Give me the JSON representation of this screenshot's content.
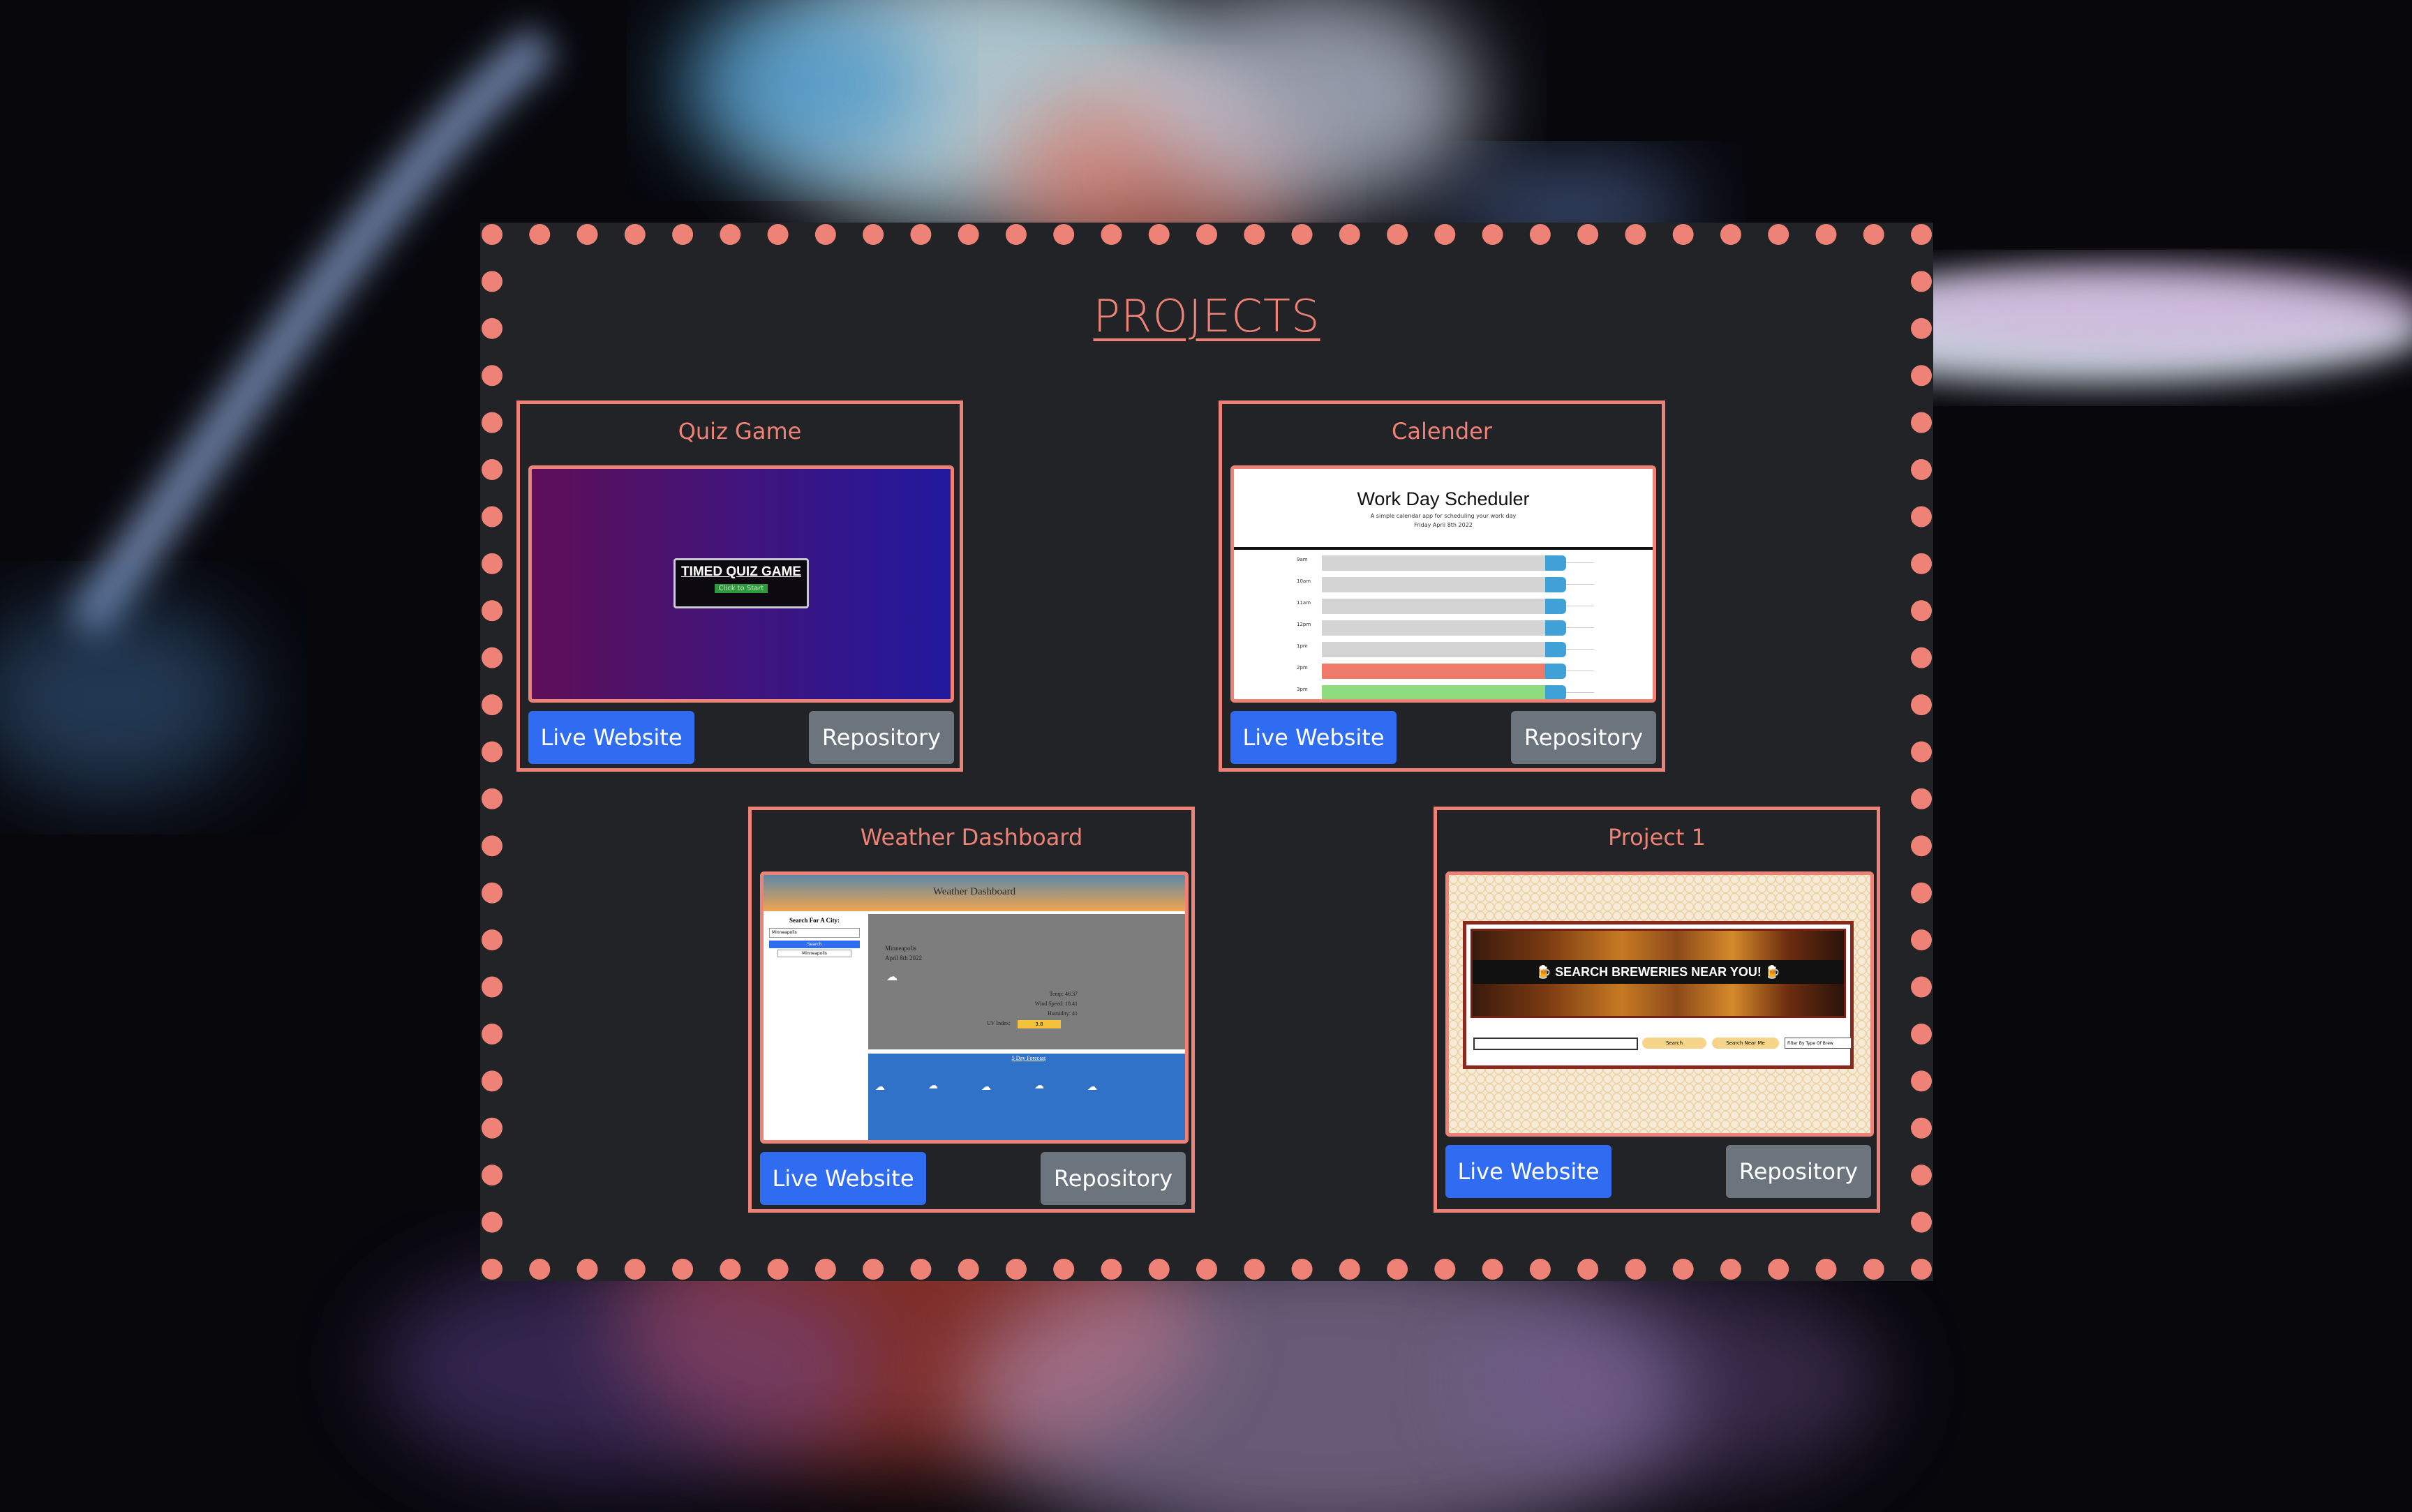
{
  "page": {
    "title": "PROJECTS"
  },
  "projects": [
    {
      "title": "Quiz Game",
      "live_label": "Live Website",
      "repo_label": "Repository",
      "preview": {
        "heading": "TIMED QUIZ GAME",
        "button": "Click to Start"
      }
    },
    {
      "title": "Calender",
      "live_label": "Live Website",
      "repo_label": "Repository",
      "preview": {
        "heading": "Work Day Scheduler",
        "subheading": "A simple calendar app for scheduling your work day",
        "date": "Friday April 8th 2022",
        "hours": [
          "9am",
          "10am",
          "11am",
          "12pm",
          "1pm",
          "2pm",
          "3pm"
        ]
      }
    },
    {
      "title": "Weather Dashboard",
      "live_label": "Live Website",
      "repo_label": "Repository",
      "preview": {
        "heading": "Weather Dashboard",
        "search_label": "Search For A City:",
        "search_value": "Minneapolis",
        "search_button": "Search",
        "history_item": "Minneapolis",
        "city": "Minneapolis",
        "date": "April 8th 2022",
        "temp": "Temp: 46.37",
        "wind": "Wind Speed: 18.41",
        "humidity": "Humidity: 41",
        "uv_label": "UV Index:",
        "uv_value": "3.8",
        "forecast_title": "5 Day Forecast"
      }
    },
    {
      "title": "Project 1",
      "live_label": "Live Website",
      "repo_label": "Repository",
      "preview": {
        "banner": "🍺 SEARCH BREWERIES NEAR YOU! 🍺",
        "search_button": "Search",
        "near_button": "Search Near Me",
        "filter": "Filter By Type Of Brew"
      }
    }
  ],
  "colors": {
    "accent": "#ee8276",
    "panel": "#222326",
    "live_button": "#2f6cf2",
    "repo_button": "#6c757d"
  }
}
